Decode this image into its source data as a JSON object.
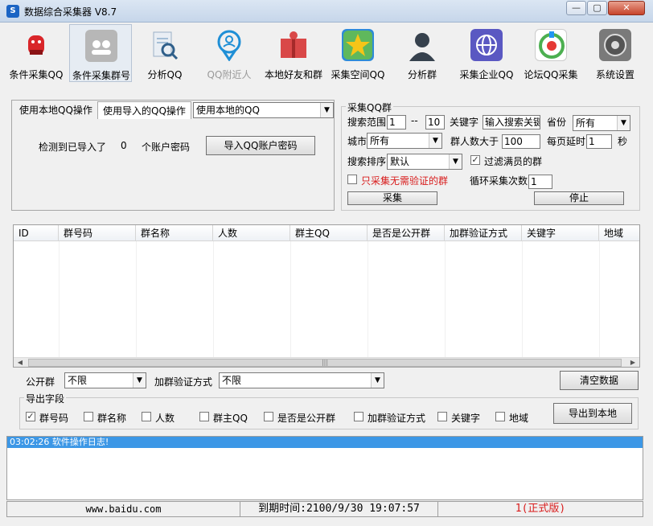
{
  "window": {
    "title": "数据综合采集器 V8.7",
    "controls": {
      "minimize": "—",
      "maximize": "▢",
      "close": "✕"
    }
  },
  "toolbar": {
    "items": [
      {
        "label": "条件采集QQ",
        "icon": "penguin-icon",
        "color": "#d9262a",
        "active": false,
        "enabled": true
      },
      {
        "label": "条件采集群号",
        "icon": "group-icon",
        "color": "#b7b7b7",
        "active": true,
        "enabled": true
      },
      {
        "label": "分析QQ",
        "icon": "magnifier-doc-icon",
        "color": "#5f8fb8",
        "active": false,
        "enabled": true
      },
      {
        "label": "QQ附近人",
        "icon": "location-pin-icon",
        "color": "#1f8fd6",
        "active": false,
        "enabled": false
      },
      {
        "label": "本地好友和群",
        "icon": "book-user-icon",
        "color": "#d94848",
        "active": false,
        "enabled": true
      },
      {
        "label": "采集空间QQ",
        "icon": "star-space-icon",
        "color": "#2e8bd8",
        "active": false,
        "enabled": true
      },
      {
        "label": "分析群",
        "icon": "contact-silhouette-icon",
        "color": "#36414d",
        "active": false,
        "enabled": true
      },
      {
        "label": "采集企业QQ",
        "icon": "globe-icon",
        "color": "#5a58c2",
        "active": false,
        "enabled": true
      },
      {
        "label": "论坛QQ采集",
        "icon": "forum-icon",
        "color": "#4caf50",
        "active": false,
        "enabled": true
      },
      {
        "label": "系统设置",
        "icon": "settings-icon",
        "color": "#7a7a7a",
        "active": false,
        "enabled": true
      }
    ]
  },
  "account_panel": {
    "tab_local": "使用本地QQ操作",
    "tab_import": "使用导入的QQ操作",
    "account_select": "使用本地的QQ",
    "detected_prefix": "检测到已导入了",
    "detected_count": "0",
    "detected_suffix": "个账户密码",
    "import_button": "导入QQ账户密码"
  },
  "collect_group": {
    "legend": "采集QQ群",
    "search_range_label": "搜索范围",
    "range_from": "1",
    "range_sep": "--",
    "range_to": "10",
    "keyword_label": "关键字",
    "keyword_value": "输入搜索关键",
    "province_label": "省份",
    "province_value": "所有",
    "city_label": "城市",
    "city_value": "所有",
    "members_label": "群人数大于",
    "members_value": "100",
    "delay_label": "每页延时",
    "delay_value": "1",
    "delay_unit": "秒",
    "sort_label": "搜索排序",
    "sort_value": "默认",
    "filter_full_label": "过滤满员的群",
    "filter_full_checked": true,
    "only_no_verify_label": "只采集无需验证的群",
    "only_no_verify_checked": false,
    "loop_label": "循环采集次数",
    "loop_value": "1",
    "collect_button": "采集",
    "stop_button": "停止"
  },
  "grid": {
    "columns": [
      "ID",
      "群号码",
      "群名称",
      "人数",
      "群主QQ",
      "是否是公开群",
      "加群验证方式",
      "关键字",
      "地域"
    ],
    "rows": [],
    "scroll_left": "◀",
    "scroll_right": "▶",
    "scroll_grip": "|||"
  },
  "filters": {
    "public_label": "公开群",
    "public_value": "不限",
    "verify_label": "加群验证方式",
    "verify_value": "不限",
    "clear_button": "清空数据"
  },
  "export": {
    "legend": "导出字段",
    "fields": [
      {
        "label": "群号码",
        "checked": true
      },
      {
        "label": "群名称",
        "checked": false
      },
      {
        "label": "人数",
        "checked": false
      },
      {
        "label": "群主QQ",
        "checked": false
      },
      {
        "label": "是否是公开群",
        "checked": false
      },
      {
        "label": "加群验证方式",
        "checked": false
      },
      {
        "label": "关键字",
        "checked": false
      },
      {
        "label": "地域",
        "checked": false
      }
    ],
    "export_button": "导出到本地"
  },
  "log": {
    "entries": [
      "03:02:26 软件操作日志!"
    ]
  },
  "statusbar": {
    "website": "www.baidu.com",
    "expiry": "到期时间:2100/9/30 19:07:57",
    "edition": "1(正式版)",
    "edition_color": "#d81b1b"
  }
}
